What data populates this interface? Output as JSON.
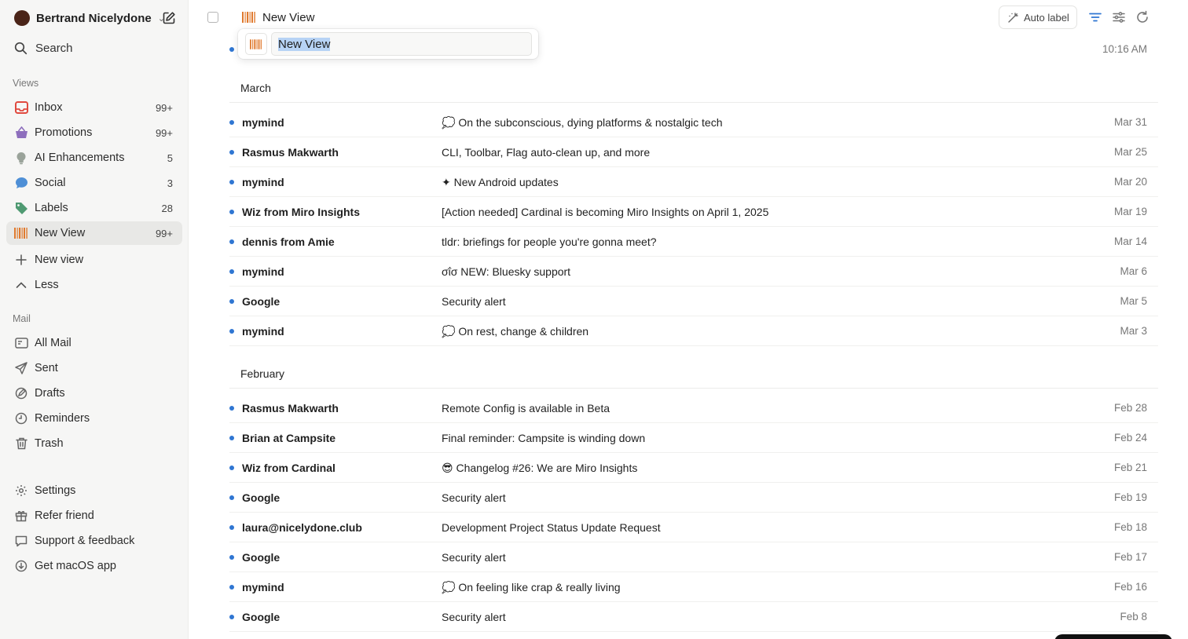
{
  "account": {
    "name": "Bertrand Nicelydone"
  },
  "search": {
    "label": "Search"
  },
  "sections": {
    "views": "Views",
    "mail": "Mail"
  },
  "views": [
    {
      "label": "Inbox",
      "count": "99+",
      "icon": "inbox-icon"
    },
    {
      "label": "Promotions",
      "count": "99+",
      "icon": "basket-icon"
    },
    {
      "label": "AI Enhancements",
      "count": "5",
      "icon": "bulb-icon"
    },
    {
      "label": "Social",
      "count": "3",
      "icon": "chat-bubble-icon"
    },
    {
      "label": "Labels",
      "count": "28",
      "icon": "tag-icon"
    },
    {
      "label": "New View",
      "count": "99+",
      "icon": "barcode-icon"
    }
  ],
  "view_actions": {
    "new_view": "New view",
    "less": "Less"
  },
  "mail": [
    {
      "label": "All Mail",
      "icon": "all-mail-icon"
    },
    {
      "label": "Sent",
      "icon": "send-icon"
    },
    {
      "label": "Drafts",
      "icon": "drafts-icon"
    },
    {
      "label": "Reminders",
      "icon": "clock-icon"
    },
    {
      "label": "Trash",
      "icon": "trash-icon"
    }
  ],
  "footer": [
    {
      "label": "Settings",
      "icon": "gear-icon"
    },
    {
      "label": "Refer friend",
      "icon": "gift-icon"
    },
    {
      "label": "Support & feedback",
      "icon": "feedback-icon"
    },
    {
      "label": "Get macOS app",
      "icon": "download-icon"
    }
  ],
  "header": {
    "title": "New View",
    "auto_label": "Auto label"
  },
  "rename": {
    "value": "New View"
  },
  "top_row": {
    "time": "10:16 AM"
  },
  "groups": [
    {
      "label": "March",
      "rows": [
        {
          "sender": "mymind",
          "subject": "💭 On the subconscious, dying platforms & nostalgic tech",
          "date": "Mar 31"
        },
        {
          "sender": "Rasmus Makwarth",
          "subject": "CLI, Toolbar, Flag auto-clean up, and more",
          "date": "Mar 25"
        },
        {
          "sender": "mymind",
          "subject": "✦ New Android updates",
          "date": "Mar 20"
        },
        {
          "sender": "Wiz from Miro Insights",
          "subject": "[Action needed] Cardinal is becoming Miro Insights on April 1, 2025",
          "date": "Mar 19"
        },
        {
          "sender": "dennis from Amie",
          "subject": "tldr: briefings for people you're gonna meet?",
          "date": "Mar 14"
        },
        {
          "sender": "mymind",
          "subject": "σΐσ NEW: Bluesky support",
          "date": "Mar 6"
        },
        {
          "sender": "Google",
          "subject": "Security alert",
          "date": "Mar 5"
        },
        {
          "sender": "mymind",
          "subject": "💭 On rest, change & children",
          "date": "Mar 3"
        }
      ]
    },
    {
      "label": "February",
      "rows": [
        {
          "sender": "Rasmus Makwarth",
          "subject": "Remote Config is available in Beta",
          "date": "Feb 28"
        },
        {
          "sender": "Brian at Campsite",
          "subject": "Final reminder: Campsite is winding down",
          "date": "Feb 24"
        },
        {
          "sender": "Wiz from Cardinal",
          "subject": "😎 Changelog #26: We are Miro Insights",
          "date": "Feb 21"
        },
        {
          "sender": "Google",
          "subject": "Security alert",
          "date": "Feb 19"
        },
        {
          "sender": "laura@nicelydone.club",
          "subject": "Development Project Status Update Request",
          "date": "Feb 18"
        },
        {
          "sender": "Google",
          "subject": "Security alert",
          "date": "Feb 17"
        },
        {
          "sender": "mymind",
          "subject": "💭 On feeling like crap & really living",
          "date": "Feb 16"
        },
        {
          "sender": "Google",
          "subject": "Security alert",
          "date": "Feb 8"
        }
      ]
    }
  ],
  "colors": {
    "accent": "#2f76d2",
    "sidebar_bg": "#f6f6f5",
    "active_bg": "#e8e8e6",
    "barcode": "#e07a2e"
  }
}
